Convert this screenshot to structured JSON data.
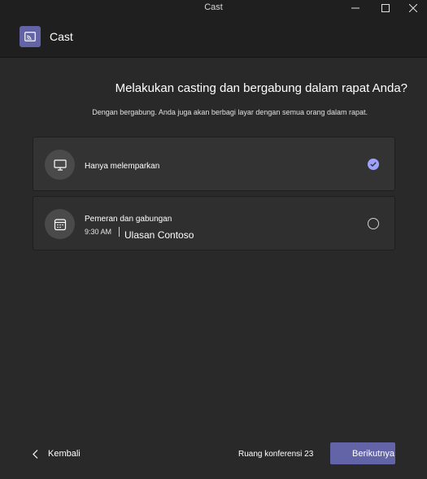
{
  "window": {
    "title": "Cast"
  },
  "header": {
    "app_title": "Cast",
    "icon": "cast-icon"
  },
  "main": {
    "heading": "Melakukan casting dan bergabung dalam rapat Anda?",
    "subheading": "Dengan bergabung. Anda juga akan berbagi layar dengan semua orang dalam rapat.",
    "options": [
      {
        "label": "Hanya melemparkan",
        "icon": "monitor-icon",
        "selected": true
      },
      {
        "label": "Pemeran dan gabungan",
        "icon": "calendar-icon",
        "time": "9:30 AM",
        "meeting": "Ulasan Contoso",
        "selected": false
      }
    ]
  },
  "footer": {
    "back_label": "Kembali",
    "room": "Ruang konferensi 23",
    "next_label": "Berikutnya"
  },
  "colors": {
    "accent": "#6264a7",
    "radio_checked": "#9ea2ff",
    "background": "#292929",
    "header": "#1f1f1f"
  }
}
